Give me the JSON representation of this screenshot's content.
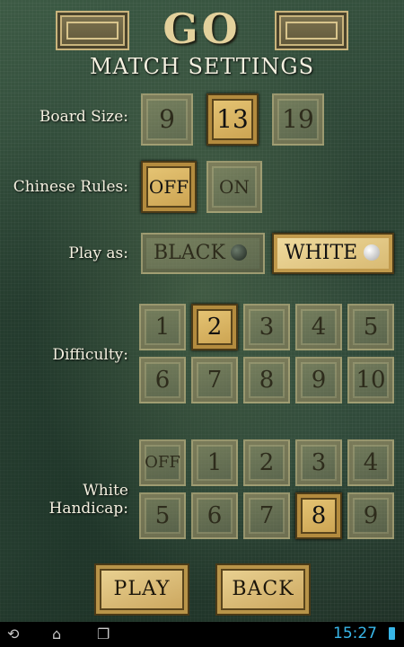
{
  "header": {
    "logo": "GO",
    "title": "MATCH SETTINGS"
  },
  "board_size": {
    "label": "Board Size:",
    "options": [
      "9",
      "13",
      "19"
    ],
    "selected": "13"
  },
  "chinese_rules": {
    "label": "Chinese Rules:",
    "options": [
      "OFF",
      "ON"
    ],
    "selected": "OFF"
  },
  "play_as": {
    "label": "Play as:",
    "options": [
      "BLACK",
      "WHITE"
    ],
    "selected": "WHITE"
  },
  "difficulty": {
    "label": "Difficulty:",
    "options": [
      "1",
      "2",
      "3",
      "4",
      "5",
      "6",
      "7",
      "8",
      "9",
      "10"
    ],
    "selected": "2"
  },
  "white_handicap": {
    "label": "White Handicap:",
    "options": [
      "OFF",
      "1",
      "2",
      "3",
      "4",
      "5",
      "6",
      "7",
      "8",
      "9"
    ],
    "selected": "8"
  },
  "actions": {
    "play": "PLAY",
    "back": "BACK"
  },
  "status_bar": {
    "time": "15:27",
    "icons": [
      "back-icon",
      "home-icon",
      "recent-apps-icon",
      "battery-icon"
    ]
  },
  "colors": {
    "selected_tile": "#d9b360",
    "clock": "#38b6e8",
    "text": "#f4f0e0"
  }
}
